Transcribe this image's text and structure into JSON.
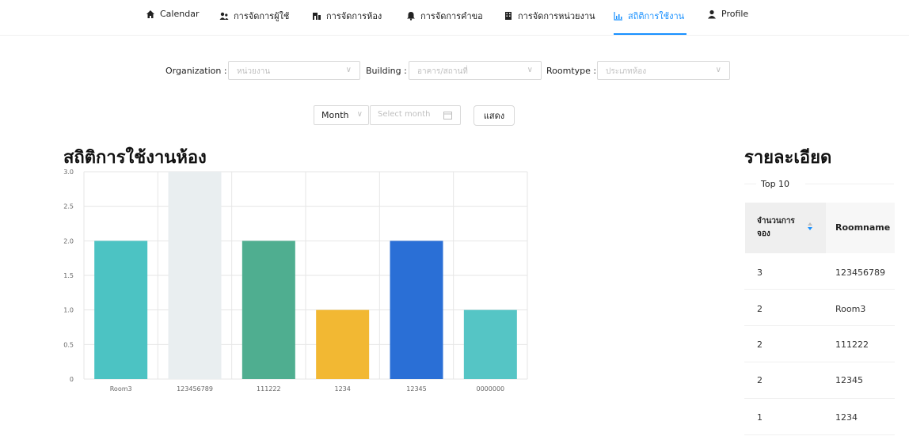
{
  "nav": {
    "items": [
      {
        "label": "Calendar",
        "icon": "home-icon"
      },
      {
        "label": "การจัดการผู้ใช้",
        "icon": "users-icon"
      },
      {
        "label": "การจัดการห้อง",
        "icon": "room-icon"
      },
      {
        "label": "การจัดการคำขอ",
        "icon": "bell-icon"
      },
      {
        "label": "การจัดการหน่วยงาน",
        "icon": "building-icon"
      },
      {
        "label": "สถิติการใช้งาน",
        "icon": "chart-icon"
      },
      {
        "label": "Profile",
        "icon": "user-icon"
      }
    ],
    "active_color": "#1890ff"
  },
  "filters": {
    "organization_label": "Organization :",
    "organization_placeholder": "หน่วยงาน",
    "building_label": "Building :",
    "building_placeholder": "อาคาร/สถานที่",
    "roomtype_label": "Roomtype :",
    "roomtype_placeholder": "ประเภทห้อง"
  },
  "controls": {
    "period_value": "Month",
    "month_placeholder": "Select month",
    "show_button": "แสดง"
  },
  "chart_title": "สถิติการใช้งานห้อง",
  "chart_data": {
    "type": "bar",
    "categories": [
      "Room3",
      "123456789",
      "111222",
      "1234",
      "12345",
      "0000000"
    ],
    "values": [
      2,
      3,
      2,
      1,
      2,
      1
    ],
    "colors": [
      "#4cc3c3",
      "#e9eef0",
      "#4fae90",
      "#f2b833",
      "#2a6fd6",
      "#55c5c5"
    ],
    "ylim": [
      0,
      3
    ],
    "yticks": [
      "0",
      "0.5",
      "1.0",
      "1.5",
      "2.0",
      "2.5",
      "3.0"
    ],
    "grid": true
  },
  "detail": {
    "title": "รายละเอียด",
    "tab": "Top 10",
    "columns": [
      "จำนวนการจอง",
      "Roomname"
    ],
    "rows": [
      {
        "count": "3",
        "room": "123456789"
      },
      {
        "count": "2",
        "room": "Room3"
      },
      {
        "count": "2",
        "room": "111222"
      },
      {
        "count": "2",
        "room": "12345"
      },
      {
        "count": "1",
        "room": "1234"
      }
    ]
  }
}
